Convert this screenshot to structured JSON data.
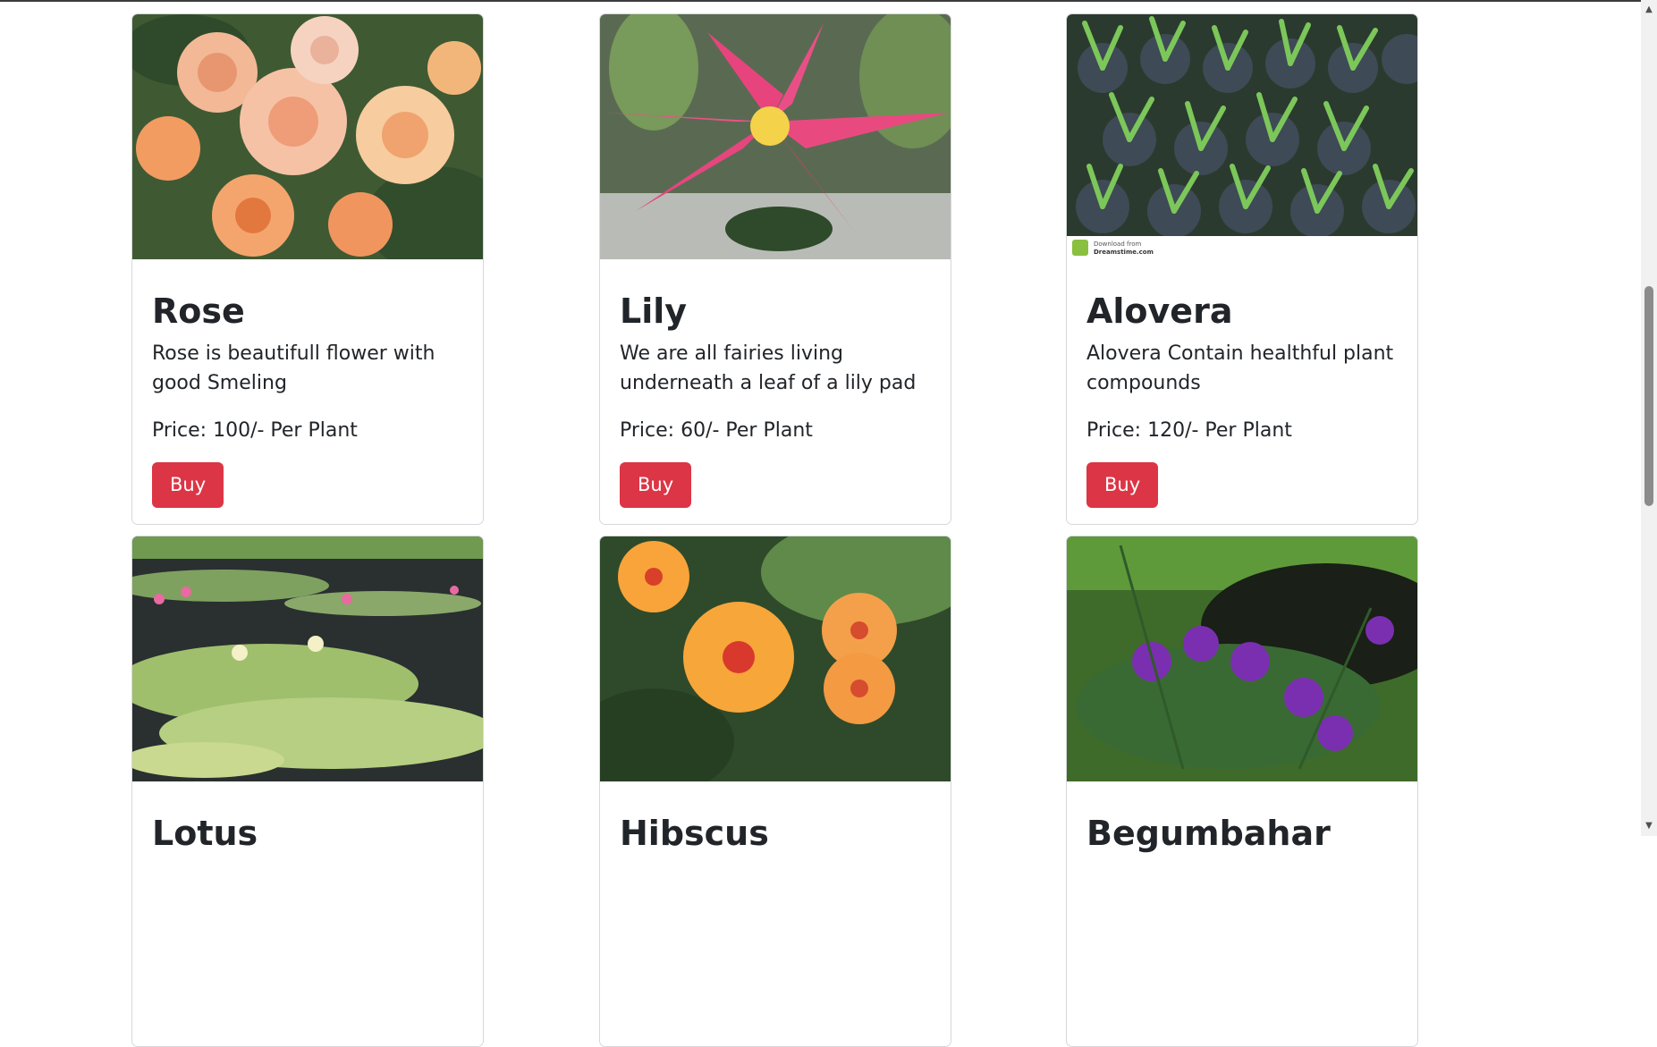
{
  "products": [
    {
      "title": "Rose",
      "description": "Rose is beautifull flower with good Smeling",
      "price": "Price: 100/- Per Plant",
      "button": "Buy"
    },
    {
      "title": "Lily",
      "description": "We are all fairies living underneath a leaf of a lily pad",
      "price": "Price: 60/- Per Plant",
      "button": "Buy"
    },
    {
      "title": "Alovera",
      "description": "Alovera Contain healthful plant compounds",
      "price": "Price: 120/- Per Plant",
      "button": "Buy"
    },
    {
      "title": "Lotus",
      "description": "",
      "price": "",
      "button": ""
    },
    {
      "title": "Hibscus",
      "description": "",
      "price": "",
      "button": ""
    },
    {
      "title": "Begumbahar",
      "description": "",
      "price": "",
      "button": ""
    }
  ],
  "watermark": {
    "line1": "Download from",
    "line2": "Dreamstime.com"
  },
  "colors": {
    "buy_button": "#dc3545",
    "card_border": "#d5d8dc"
  },
  "scrollbar": {
    "up_icon": "triangle-up",
    "down_icon": "triangle-down"
  }
}
